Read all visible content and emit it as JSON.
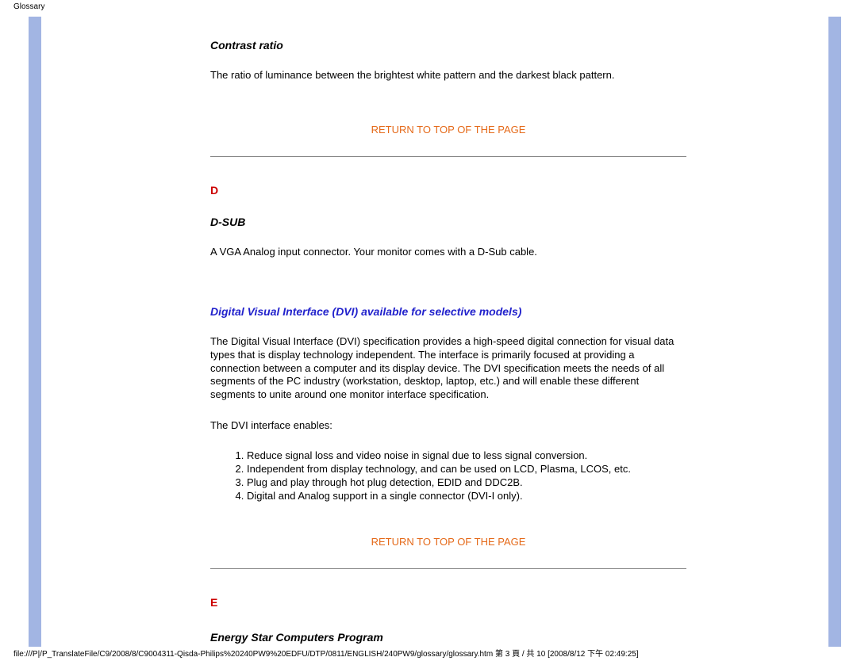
{
  "header": {
    "title": "Glossary"
  },
  "sections": {
    "contrast_ratio": {
      "title": "Contrast ratio",
      "body": "The ratio of luminance between the brightest white pattern and the darkest black pattern."
    },
    "d_letter": "D",
    "dsub": {
      "title": "D-SUB",
      "body": "A VGA Analog input connector. Your monitor comes with a D-Sub cable."
    },
    "dvi": {
      "title": "Digital Visual Interface (DVI) available for selective models)",
      "body": "The Digital Visual Interface (DVI) specification provides a high-speed digital connection for visual data types that is display technology independent. The interface is primarily focused at providing a connection between a computer and its display device. The DVI specification meets the needs of all segments of the PC industry (workstation, desktop, laptop, etc.) and will enable these different segments to unite around one monitor interface specification.",
      "list_intro": "The DVI interface enables:",
      "items": [
        "Reduce signal loss and video noise in signal due to less signal conversion.",
        "Independent from display technology, and can be used on LCD, Plasma, LCOS, etc.",
        "Plug and play through hot plug detection, EDID and DDC2B.",
        "Digital and Analog support in a single connector (DVI-I only)."
      ]
    },
    "e_letter": "E",
    "energy_star": {
      "title": "Energy Star Computers Program"
    },
    "return_label": "RETURN TO TOP OF THE PAGE"
  },
  "footer": {
    "path": "file:///P|/P_TranslateFile/C9/2008/8/C9004311-Qisda-Philips%20240PW9%20EDFU/DTP/0811/ENGLISH/240PW9/glossary/glossary.htm 第 3 頁 / 共 10  [2008/8/12 下午 02:49:25]"
  }
}
